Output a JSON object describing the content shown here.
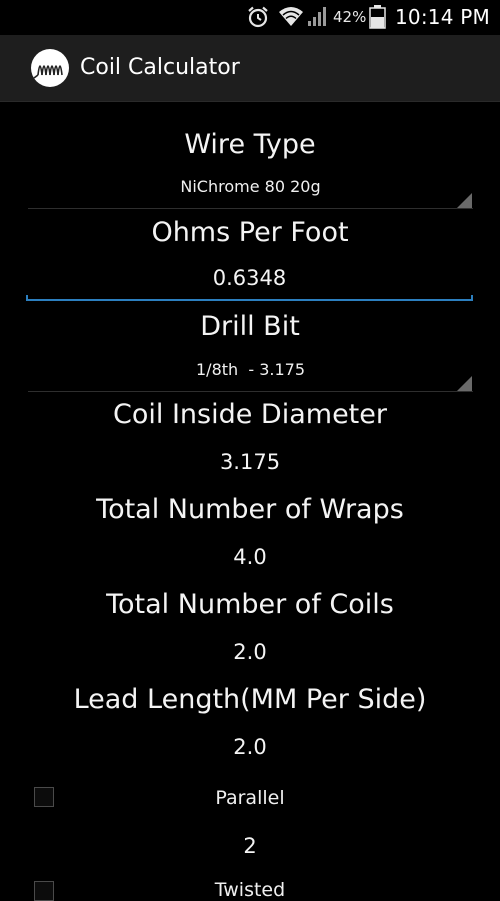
{
  "status_bar": {
    "battery_percent": "42%",
    "time": "10:14 PM",
    "icons": [
      "alarm-icon",
      "wifi-icon",
      "signal-icon",
      "battery-icon"
    ]
  },
  "action_bar": {
    "title": "Coil Calculator",
    "logo_icon": "coil-logo-icon"
  },
  "form": {
    "wire_type": {
      "label": "Wire Type",
      "selected": "NiChrome 80 20g"
    },
    "ohms_per_foot": {
      "label": "Ohms Per Foot",
      "value": "0.6348"
    },
    "drill_bit": {
      "label": "Drill Bit",
      "selected": "1/8th  - 3.175"
    },
    "coil_inside_diameter": {
      "label": "Coil Inside Diameter",
      "value": "3.175"
    },
    "total_wraps": {
      "label": "Total Number of Wraps",
      "value": "4.0"
    },
    "total_coils": {
      "label": "Total Number of Coils",
      "value": "2.0"
    },
    "lead_length": {
      "label": "Lead Length(MM Per Side)",
      "value": "2.0"
    },
    "parallel": {
      "label": "Parallel",
      "checked": false,
      "value": "2"
    },
    "twisted": {
      "label": "Twisted",
      "checked": false
    }
  },
  "colors": {
    "background": "#000000",
    "action_bar": "#1e1e1e",
    "accent_underline": "#2c7fbf",
    "text": "#ffffff"
  }
}
